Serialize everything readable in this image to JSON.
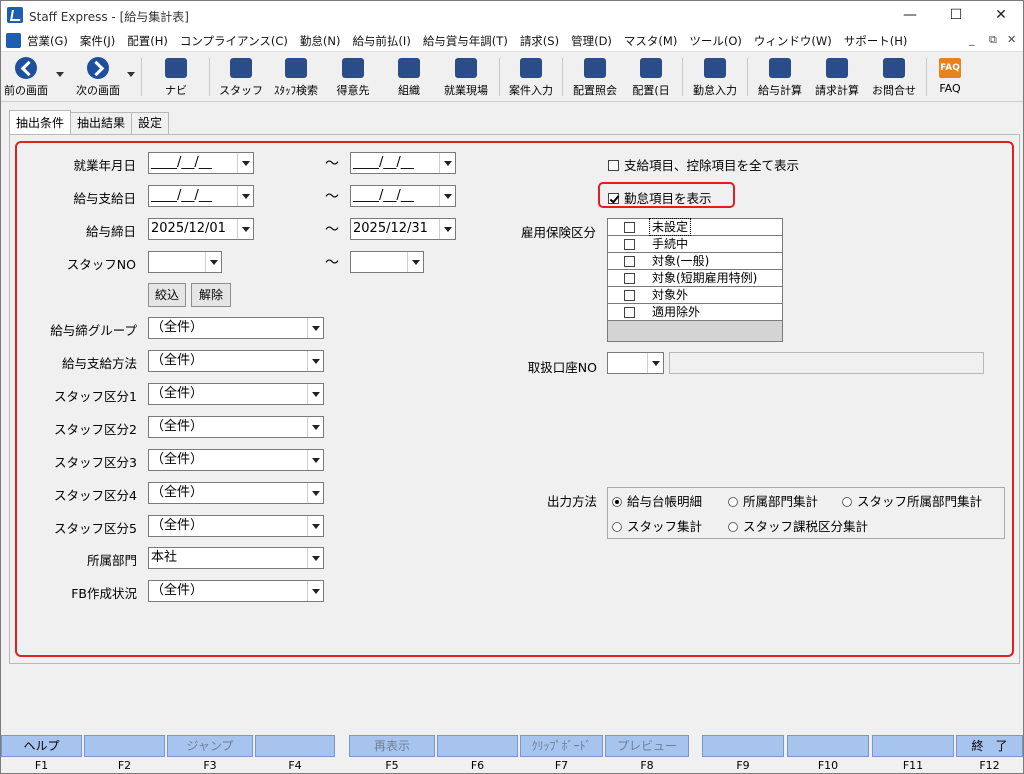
{
  "window": {
    "title": "Staff Express - [給与集計表]",
    "controls": {
      "minimize": "—",
      "maximize": "☐",
      "close": "✕"
    }
  },
  "menu": {
    "items": [
      "営業(G)",
      "案件(J)",
      "配置(H)",
      "コンプライアンス(C)",
      "勤怠(N)",
      "給与前払(I)",
      "給与賞与年調(T)",
      "請求(S)",
      "管理(D)",
      "マスタ(M)",
      "ツール(O)",
      "ウィンドウ(W)",
      "サポート(H)"
    ],
    "mdi": {
      "minimize": "_",
      "restore": "⧉",
      "close": "✕"
    }
  },
  "toolbar": {
    "back": "前の画面",
    "forward": "次の画面",
    "navi": "ナビ",
    "staff": "スタッフ",
    "staff_search": "ｽﾀｯﾌ検索",
    "client": "得意先",
    "org": "組織",
    "site": "就業現場",
    "case_input": "案件入力",
    "assign_inquiry": "配置照会",
    "assign_day": "配置(日",
    "attendance_input": "勤怠入力",
    "payroll_calc": "給与計算",
    "billing_calc": "請求計算",
    "contact": "お問合せ",
    "faq": "FAQ",
    "faq_icon_text": "FAQ"
  },
  "tabs": [
    "抽出条件",
    "抽出結果",
    "設定"
  ],
  "form": {
    "work_date": {
      "label": "就業年月日",
      "from": "____/__/__",
      "to": "____/__/__"
    },
    "pay_date": {
      "label": "給与支給日",
      "from": "____/__/__",
      "to": "____/__/__"
    },
    "close_date": {
      "label": "給与締日",
      "from": "2025/12/01",
      "to": "2025/12/31"
    },
    "staff_no": {
      "label": "スタッフNO",
      "from": "",
      "to": ""
    },
    "tilde": "～",
    "filter_button": "絞込",
    "clear_button": "解除",
    "close_group": {
      "label": "給与締グループ",
      "value": "（全件）"
    },
    "pay_method": {
      "label": "給与支給方法",
      "value": "（全件）"
    },
    "staff_cat1": {
      "label": "スタッフ区分1",
      "value": "（全件）"
    },
    "staff_cat2": {
      "label": "スタッフ区分2",
      "value": "（全件）"
    },
    "staff_cat3": {
      "label": "スタッフ区分3",
      "value": "（全件）"
    },
    "staff_cat4": {
      "label": "スタッフ区分4",
      "value": "（全件）"
    },
    "staff_cat5": {
      "label": "スタッフ区分5",
      "value": "（全件）"
    },
    "department": {
      "label": "所属部門",
      "value": "本社"
    },
    "fb_status": {
      "label": "FB作成状況",
      "value": "（全件）"
    },
    "show_all_items": {
      "label": "支給項目、控除項目を全て表示",
      "checked": false
    },
    "show_attendance": {
      "label": "勤怠項目を表示",
      "checked": true
    },
    "employment_insurance": {
      "label": "雇用保険区分",
      "options": [
        "未設定",
        "手続中",
        "対象(一般)",
        "対象(短期雇用特例)",
        "対象外",
        "適用除外"
      ]
    },
    "account_no": {
      "label": "取扱口座NO",
      "value": "",
      "name": ""
    },
    "output_method": {
      "label": "出力方法",
      "options": [
        "給与台帳明細",
        "所属部門集計",
        "スタッフ所属部門集計",
        "スタッフ集計",
        "スタッフ課税区分集計"
      ],
      "selected": "給与台帳明細"
    }
  },
  "fkeys": [
    {
      "label": "ヘルプ",
      "num": "F1"
    },
    {
      "label": "",
      "num": "F2"
    },
    {
      "label": "ジャンプ",
      "num": "F3"
    },
    {
      "label": "",
      "num": "F4"
    },
    {
      "label": "再表示",
      "num": "F5"
    },
    {
      "label": "",
      "num": "F6"
    },
    {
      "label": "ｸﾘｯﾌﾟﾎﾞｰﾄﾞ",
      "num": "F7"
    },
    {
      "label": "プレビュー",
      "num": "F8"
    },
    {
      "label": "",
      "num": "F9"
    },
    {
      "label": "",
      "num": "F10"
    },
    {
      "label": "",
      "num": "F11"
    },
    {
      "label": "終　了",
      "num": "F12"
    }
  ]
}
